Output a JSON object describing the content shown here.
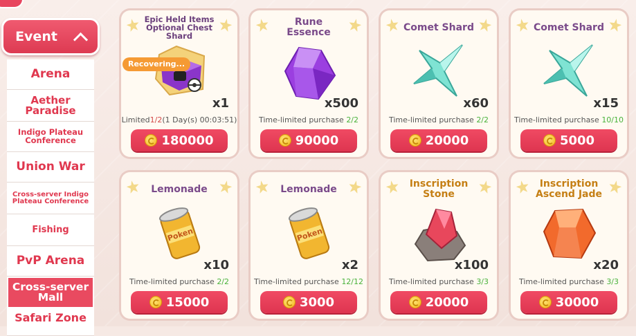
{
  "sidebar": {
    "event_label": "Event",
    "items": [
      {
        "label": "Arena"
      },
      {
        "label": "Aether Paradise"
      },
      {
        "label": "Indigo Plateau Conference"
      },
      {
        "label": "Union War"
      },
      {
        "label": "Cross-server Indigo Plateau Conference"
      },
      {
        "label": "Fishing"
      },
      {
        "label": "PvP Arena"
      },
      {
        "label": "Cross-server Mall",
        "active": true
      },
      {
        "label": "Safari Zone"
      }
    ]
  },
  "items": [
    {
      "name": "Epic Held Items Optional Chest Shard",
      "icon": "chest-shard-icon",
      "qty": "x1",
      "limit_prefix": "Limited",
      "limit_count": "1/2",
      "limit_suffix": "(1 Day(s) 00:03:51)",
      "badge": "Recovering...",
      "price": "180000"
    },
    {
      "name": "Rune Essence",
      "icon": "rune-essence-icon",
      "qty": "x500",
      "limit_prefix": "Time-limited purchase ",
      "limit_count": "2/2",
      "limit_suffix": "",
      "price": "90000"
    },
    {
      "name": "Comet Shard",
      "icon": "comet-shard-icon",
      "qty": "x60",
      "limit_prefix": "Time-limited purchase ",
      "limit_count": "2/2",
      "limit_suffix": "",
      "price": "20000"
    },
    {
      "name": "Comet Shard",
      "icon": "comet-shard-icon",
      "qty": "x15",
      "limit_prefix": "Time-limited purchase ",
      "limit_count": "10/10",
      "limit_suffix": "",
      "price": "5000"
    },
    {
      "name": "Lemonade",
      "icon": "lemonade-can-icon",
      "qty": "x10",
      "limit_prefix": "Time-limited purchase ",
      "limit_count": "2/2",
      "limit_suffix": "",
      "price": "15000"
    },
    {
      "name": "Lemonade",
      "icon": "lemonade-can-icon",
      "qty": "x2",
      "limit_prefix": "Time-limited purchase ",
      "limit_count": "12/12",
      "limit_suffix": "",
      "price": "3000"
    },
    {
      "name": "Inscription Stone",
      "icon": "inscription-stone-icon",
      "qty": "x100",
      "limit_prefix": "Time-limited purchase ",
      "limit_count": "3/3",
      "limit_suffix": "",
      "price": "20000"
    },
    {
      "name": "Inscription Ascend Jade",
      "icon": "ascend-jade-icon",
      "qty": "x20",
      "limit_prefix": "Time-limited purchase ",
      "limit_count": "3/3",
      "limit_suffix": "",
      "price": "30000"
    }
  ]
}
